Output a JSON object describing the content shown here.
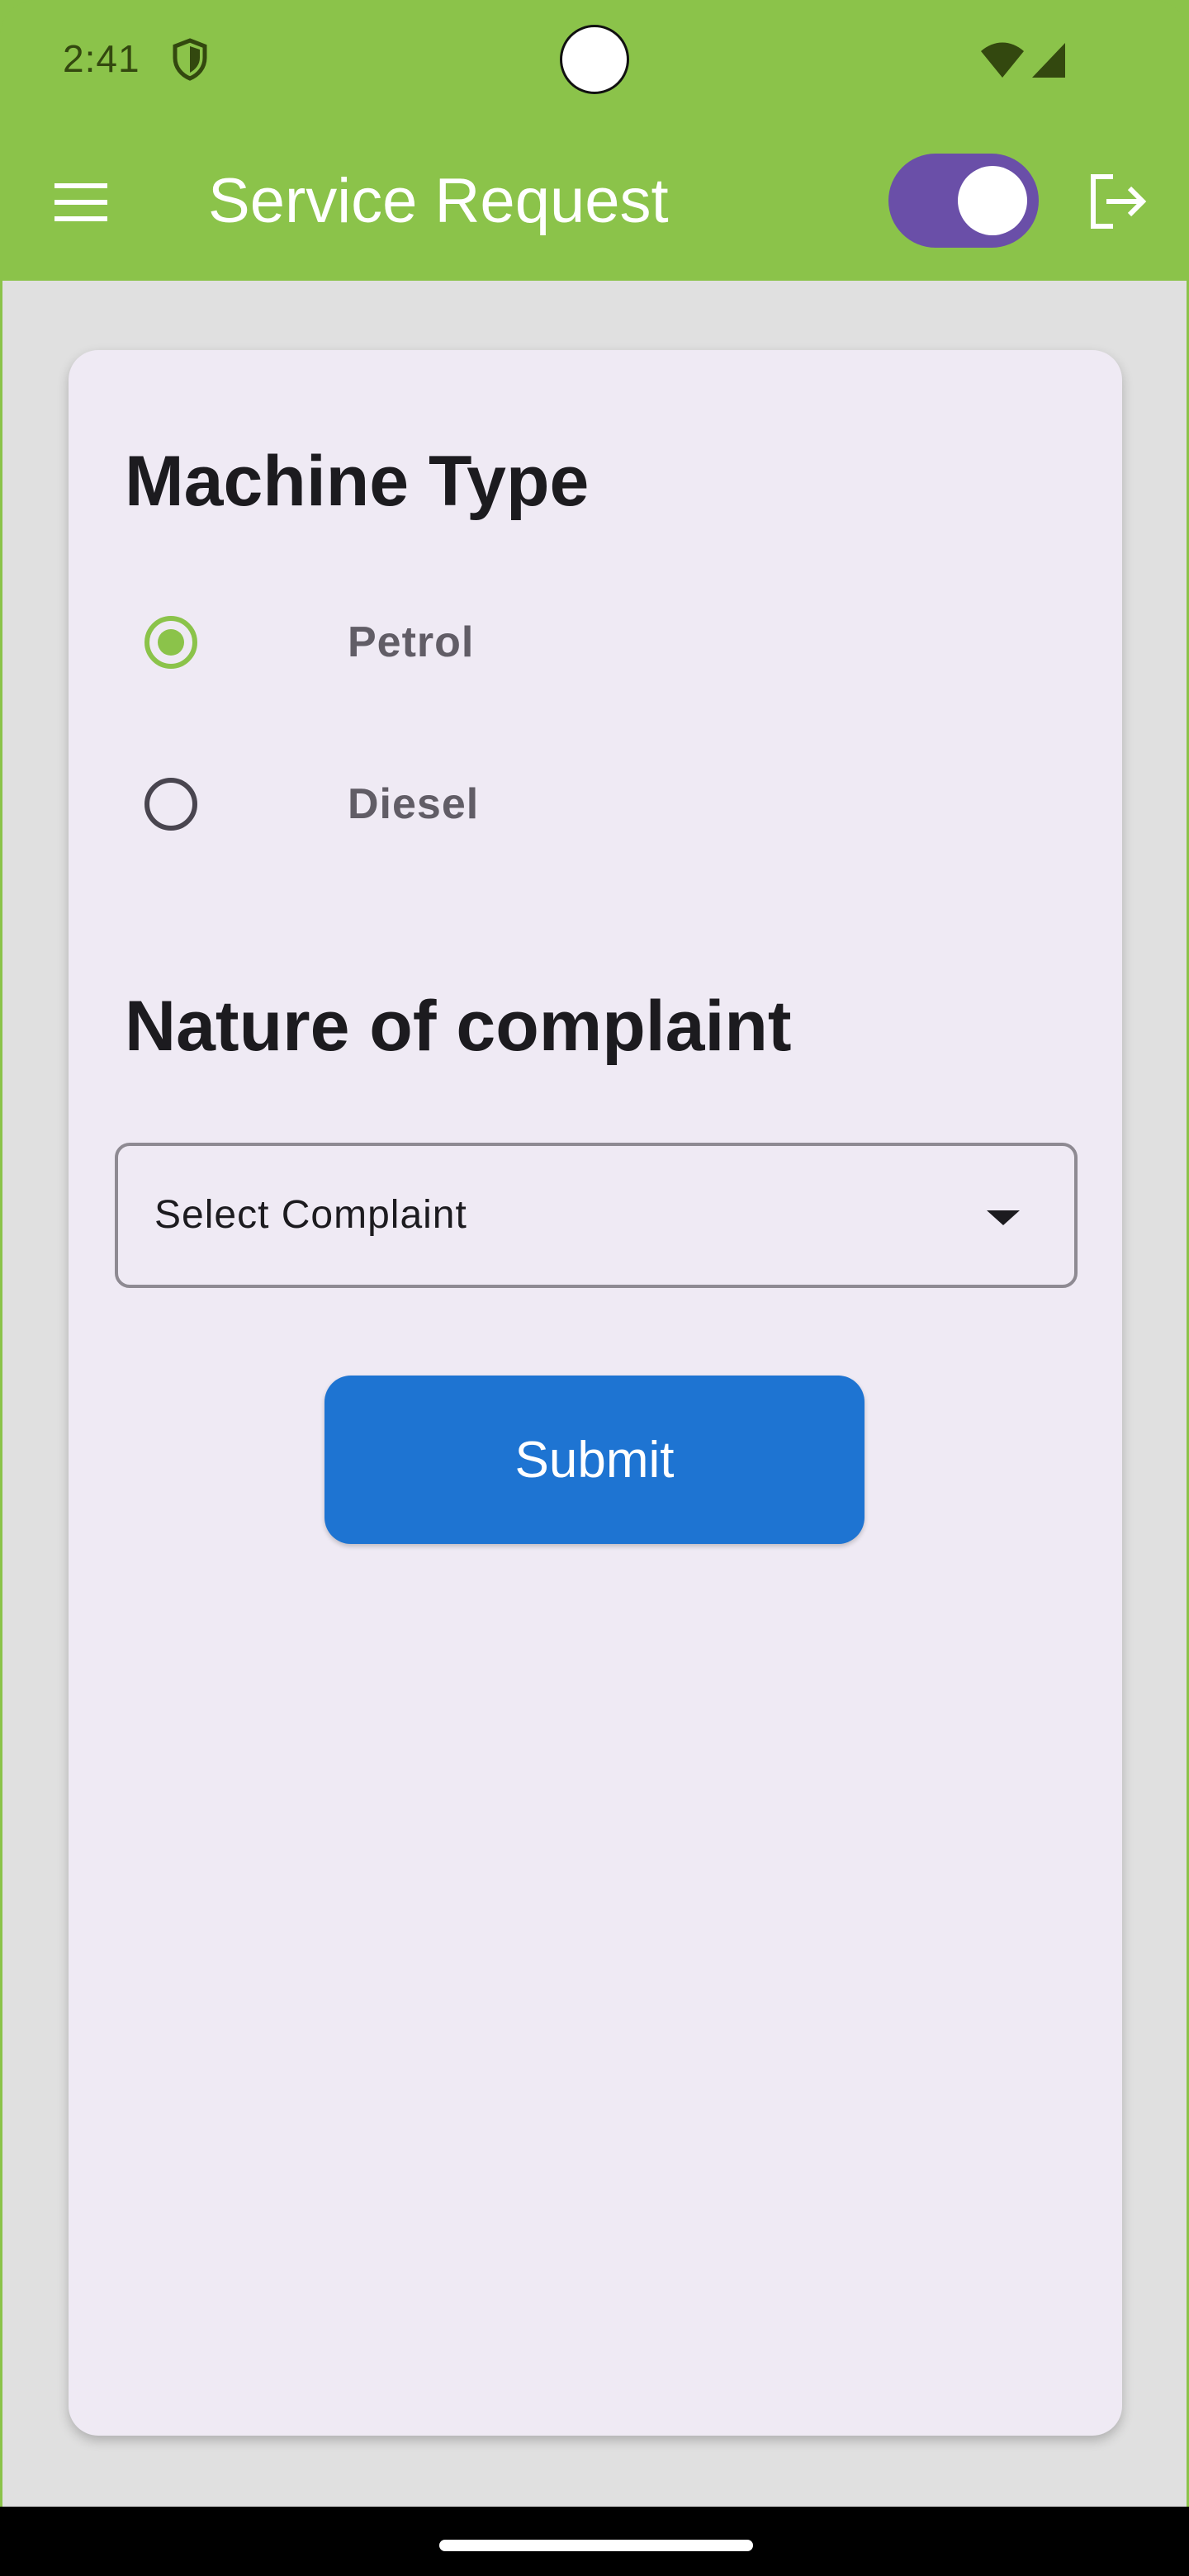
{
  "status_bar": {
    "time": "2:41",
    "icons": [
      "shield-icon",
      "wifi-icon",
      "signal-icon"
    ]
  },
  "app_bar": {
    "title": "Service Request",
    "menu_icon": "menu-icon",
    "logout_icon": "logout-icon",
    "toggle_on": true,
    "colors": {
      "background": "#8bc34a",
      "toggle_track": "#6a4fa8"
    }
  },
  "form": {
    "machine_type": {
      "title": "Machine Type",
      "options": [
        {
          "label": "Petrol",
          "selected": true
        },
        {
          "label": "Diesel",
          "selected": false
        }
      ]
    },
    "complaint": {
      "title": "Nature of complaint",
      "dropdown_value": "Select Complaint"
    },
    "submit_label": "Submit",
    "colors": {
      "accent": "#8bc34a",
      "button": "#1e74d2",
      "card": "#efeaf4"
    }
  }
}
